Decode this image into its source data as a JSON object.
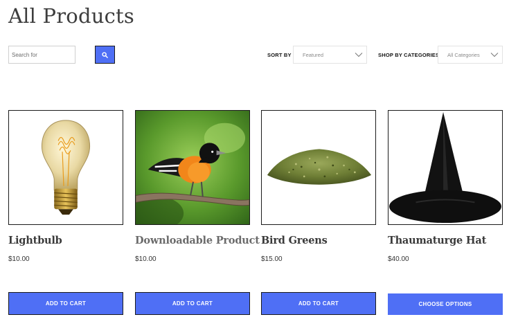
{
  "page": {
    "title": "All Products"
  },
  "toolbar": {
    "search_placeholder": "Search for",
    "sort_label": "SORT BY",
    "sort_value": "Featured",
    "category_label": "SHOP BY CATEGORIES",
    "category_value": "All Categories",
    "accent_color": "#4f6ff5"
  },
  "products": [
    {
      "name": "Lightbulb",
      "price": "$10.00",
      "button": "ADD TO CART",
      "image": "lightbulb"
    },
    {
      "name": "Downloadable Product",
      "price": "$10.00",
      "button": "ADD TO CART",
      "image": "oriole-bird"
    },
    {
      "name": "Bird Greens",
      "price": "$15.00",
      "button": "ADD TO CART",
      "image": "dried-greens-pile"
    },
    {
      "name": "Thaumaturge Hat",
      "price": "$40.00",
      "button": "CHOOSE OPTIONS",
      "image": "witch-hat"
    }
  ]
}
